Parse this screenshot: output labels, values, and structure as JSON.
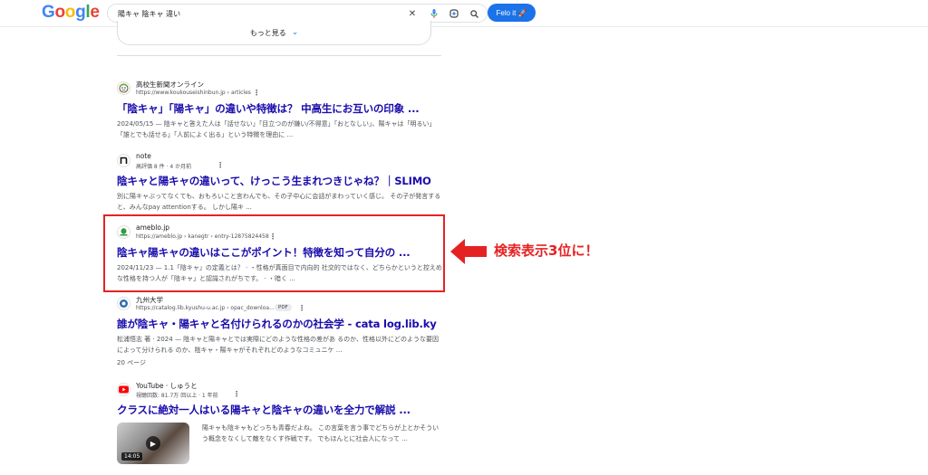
{
  "header": {
    "logo_letters": [
      "G",
      "o",
      "o",
      "g",
      "l",
      "e"
    ],
    "search_value": "陽キャ 陰キャ 違い",
    "felo_label": "Felo it 🚀"
  },
  "more_label": "もっと見る",
  "results": [
    {
      "site_name": "高校生新聞オンライン",
      "url": "https://www.koukouseishinbun.jp › articles",
      "title": "「陰キャ」「陽キャ」の違いや特徴は？ 中高生にお互いの印象 ...",
      "snippet": "2024/05/15 — 陰キャと答えた人は「話せない」「目立つのが嫌い/不得意」「おとなしい」、陽キャは「明るい」「誰とでも話せる」「人前によく出る」という特徴を理由に ..."
    },
    {
      "site_name": "note",
      "url": "高評価 8 件 · 4 か月前",
      "title": "陰キャと陽キャの違いって、けっこう生まれつきじゃね？｜SLIMO",
      "snippet": "別に陽キャぶってなくても、おもろいこと言わんでも、その子中心に会話がまわっていく感じ。 その子が発言すると、みんなpay attentionする。 しかし陽キ ..."
    },
    {
      "site_name": "ameblo.jp",
      "url": "https://ameblo.jp › kanegtr › entry-12875824458",
      "title": "陰キャ陽キャの違いはここがポイント！特徴を知って自分の ...",
      "snippet": "2024/11/23 — 1.1「陰キャ」の定義とは？ · ・性格が真面目で内向的 社交的ではなく、どちらかというと控えめな性格を持つ人が「陰キャ」と認識されがちです。 · ・暗く ..."
    },
    {
      "site_name": "九州大学",
      "url": "https://catalog.lib.kyushu-u.ac.jp › opac_downloa...",
      "badge": "PDF",
      "title": "誰が陰キャ・陽キャと名付けられるのかの社会学 - cata log.lib.ky",
      "snippet": "松浦悟志 著 · 2024 — 陰キャと陽キャとでは実際にどのような性格の差があ るのか、性格以外にどのような要因によって分けられる のか、陰キャ・陽キャがそれぞれどのようなコミュニケ ...",
      "pages": "20 ページ"
    },
    {
      "site_name": "YouTube · しゅうと",
      "url": "視聴回数: 81.7万 回以上 · 1 年前",
      "title": "クラスに絶対一人はいる陽キャと陰キャの違いを全力で解説 ...",
      "snippet": "陽キャも陰キャもどっちも青春だよね。 この言葉を言う事でどちらが上とかそういう概念をなくして敵をなくす作戦です。 でもほんとに社会人になって ...",
      "duration": "14:05"
    }
  ],
  "annotation_text": "検索表示3位に！",
  "colors": {
    "accent": "#1a73e8",
    "link": "#1a0dab",
    "highlight": "#e52222"
  }
}
